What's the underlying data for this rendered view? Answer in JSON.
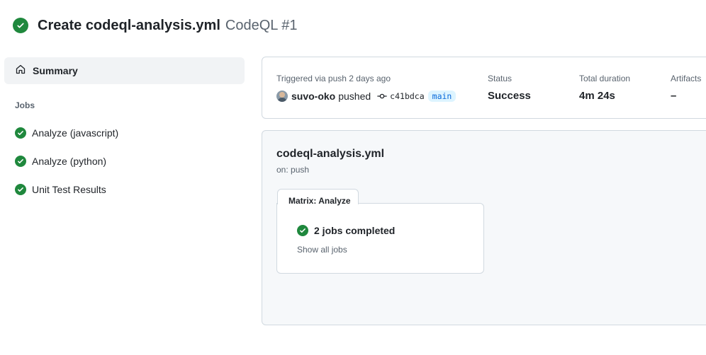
{
  "header": {
    "title": "Create codeql-analysis.yml",
    "subtitle": "CodeQL #1"
  },
  "sidebar": {
    "summary_label": "Summary",
    "jobs_heading": "Jobs",
    "jobs": [
      {
        "label": "Analyze (javascript)"
      },
      {
        "label": "Analyze (python)"
      },
      {
        "label": "Unit Test Results"
      }
    ]
  },
  "run_info": {
    "trigger_label": "Triggered via push 2 days ago",
    "actor": "suvo-oko",
    "action": "pushed",
    "commit_sha": "c41bdca",
    "branch": "main",
    "status_label": "Status",
    "status_value": "Success",
    "duration_label": "Total duration",
    "duration_value": "4m 24s",
    "artifacts_label": "Artifacts",
    "artifacts_value": "–"
  },
  "workflow": {
    "file_name": "codeql-analysis.yml",
    "trigger": "on: push",
    "matrix_label": "Matrix: Analyze",
    "jobs_completed": "2 jobs completed",
    "show_all": "Show all jobs"
  },
  "colors": {
    "success": "#1f883d",
    "link": "#0969da",
    "muted": "#59636e"
  },
  "icons": {
    "status": "check-circle-icon",
    "summary": "home-icon",
    "commit": "git-commit-icon"
  }
}
